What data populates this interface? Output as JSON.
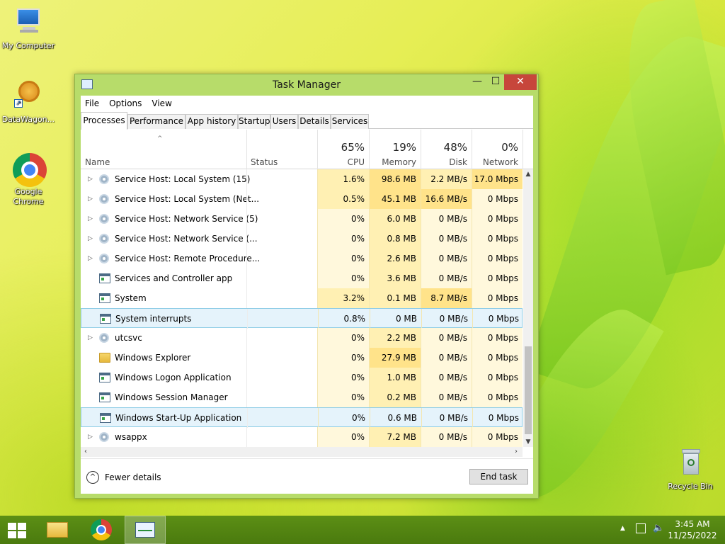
{
  "desktop": {
    "icons": [
      {
        "label": "My Computer",
        "icon": "computer-icon"
      },
      {
        "label": "DataWagon...",
        "icon": "datawagon-icon"
      },
      {
        "label": "Google Chrome",
        "icon": "chrome-icon"
      },
      {
        "label": "Recycle Bin",
        "icon": "recycle-bin-icon"
      }
    ]
  },
  "window": {
    "title": "Task Manager",
    "menu": [
      "File",
      "Options",
      "View"
    ],
    "tabs": [
      "Processes",
      "Performance",
      "App history",
      "Startup",
      "Users",
      "Details",
      "Services"
    ],
    "active_tab": "Processes",
    "columns": {
      "name": "Name",
      "status": "Status",
      "cpu": {
        "label": "CPU",
        "pct": "65%"
      },
      "memory": {
        "label": "Memory",
        "pct": "19%"
      },
      "disk": {
        "label": "Disk",
        "pct": "48%"
      },
      "network": {
        "label": "Network",
        "pct": "0%"
      }
    },
    "processes": [
      {
        "name": "Service Host: Local System (15)",
        "expandable": true,
        "icon": "gear",
        "cpu": "1.6%",
        "memory": "98.6 MB",
        "disk": "2.2 MB/s",
        "network": "17.0 Mbps"
      },
      {
        "name": "Service Host: Local System (Net...",
        "expandable": true,
        "icon": "gear",
        "cpu": "0.5%",
        "memory": "45.1 MB",
        "disk": "16.6 MB/s",
        "network": "0 Mbps"
      },
      {
        "name": "Service Host: Network Service (5)",
        "expandable": true,
        "icon": "gear",
        "cpu": "0%",
        "memory": "6.0 MB",
        "disk": "0 MB/s",
        "network": "0 Mbps"
      },
      {
        "name": "Service Host: Network Service (...",
        "expandable": true,
        "icon": "gear",
        "cpu": "0%",
        "memory": "0.8 MB",
        "disk": "0 MB/s",
        "network": "0 Mbps"
      },
      {
        "name": "Service Host: Remote Procedure...",
        "expandable": true,
        "icon": "gear",
        "cpu": "0%",
        "memory": "2.6 MB",
        "disk": "0 MB/s",
        "network": "0 Mbps"
      },
      {
        "name": "Services and Controller app",
        "expandable": false,
        "icon": "app",
        "cpu": "0%",
        "memory": "3.6 MB",
        "disk": "0 MB/s",
        "network": "0 Mbps"
      },
      {
        "name": "System",
        "expandable": false,
        "icon": "app",
        "cpu": "3.2%",
        "memory": "0.1 MB",
        "disk": "8.7 MB/s",
        "network": "0 Mbps"
      },
      {
        "name": "System interrupts",
        "expandable": false,
        "icon": "app",
        "cpu": "0.8%",
        "memory": "0 MB",
        "disk": "0 MB/s",
        "network": "0 Mbps"
      },
      {
        "name": "utcsvc",
        "expandable": true,
        "icon": "gear",
        "cpu": "0%",
        "memory": "2.2 MB",
        "disk": "0 MB/s",
        "network": "0 Mbps"
      },
      {
        "name": "Windows Explorer",
        "expandable": false,
        "icon": "folder",
        "cpu": "0%",
        "memory": "27.9 MB",
        "disk": "0 MB/s",
        "network": "0 Mbps"
      },
      {
        "name": "Windows Logon Application",
        "expandable": false,
        "icon": "app",
        "cpu": "0%",
        "memory": "1.0 MB",
        "disk": "0 MB/s",
        "network": "0 Mbps"
      },
      {
        "name": "Windows Session Manager",
        "expandable": false,
        "icon": "app",
        "cpu": "0%",
        "memory": "0.2 MB",
        "disk": "0 MB/s",
        "network": "0 Mbps"
      },
      {
        "name": "Windows Start-Up Application",
        "expandable": false,
        "icon": "app",
        "cpu": "0%",
        "memory": "0.6 MB",
        "disk": "0 MB/s",
        "network": "0 Mbps"
      },
      {
        "name": "wsappx",
        "expandable": true,
        "icon": "gear",
        "cpu": "0%",
        "memory": "7.2 MB",
        "disk": "0 MB/s",
        "network": "0 Mbps"
      }
    ],
    "highlighted_rows": [
      "System interrupts",
      "Windows Start-Up Application"
    ],
    "footer": {
      "fewer_details": "Fewer details",
      "end_task": "End task"
    }
  },
  "taskbar": {
    "items": [
      "start-icon",
      "file-explorer-icon",
      "chrome-icon",
      "task-manager-icon"
    ],
    "active_item": "task-manager-icon",
    "tray": [
      "show-hidden-icons-icon",
      "network-icon",
      "volume-icon"
    ],
    "time": "3:45 AM",
    "date": "11/25/2022"
  },
  "colors": {
    "window_frame": "#b7dc6a",
    "close_button": "#c7463b",
    "heat_light": "#fff8dc",
    "heat_mid": "#fff0b3",
    "heat_high": "#ffe38a",
    "selection": "#e5f3fb",
    "taskbar": "#4a7a0e"
  }
}
